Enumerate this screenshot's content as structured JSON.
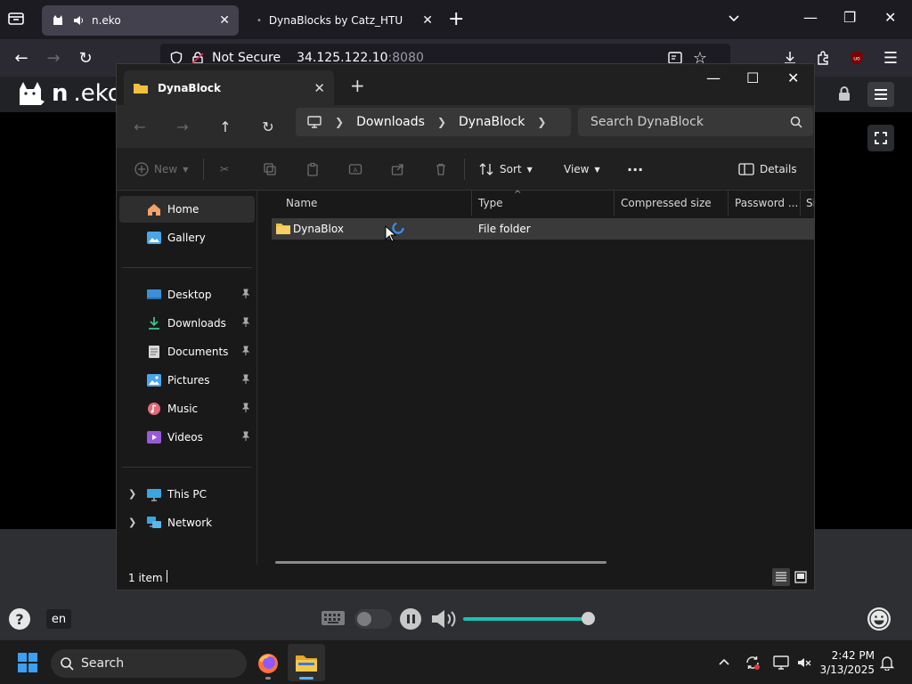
{
  "browser": {
    "tabs": [
      {
        "title": "n.eko",
        "active": true
      },
      {
        "title": "DynaBlocks by Catz_HTU",
        "active": false
      }
    ],
    "security_label": "Not Secure",
    "url_host": "34.125.122.10",
    "url_port": ":8080"
  },
  "neko": {
    "logo_bold": "n",
    "logo_rest": ".eko",
    "language": "en",
    "help": "?",
    "volume_fraction": 0.95
  },
  "explorer": {
    "tab_title": "DynaBlock",
    "breadcrumb": [
      "Downloads",
      "DynaBlock"
    ],
    "search_placeholder": "Search DynaBlock",
    "toolbar": {
      "new_label": "New",
      "sort_label": "Sort",
      "view_label": "View",
      "more_label": "···",
      "details_label": "Details"
    },
    "sidebar": {
      "home": "Home",
      "gallery": "Gallery",
      "quick": [
        "Desktop",
        "Downloads",
        "Documents",
        "Pictures",
        "Music",
        "Videos"
      ],
      "this_pc": "This PC",
      "network": "Network"
    },
    "columns": [
      "Name",
      "Type",
      "Compressed size",
      "Password ...",
      "Si"
    ],
    "files": [
      {
        "name": "DynaBlox",
        "type": "File folder"
      }
    ],
    "status_count": "1 item"
  },
  "taskbar": {
    "search_placeholder": "Search",
    "time": "2:42 PM",
    "date": "3/13/2025"
  },
  "colors": {
    "accent": "#3aa0f3",
    "folder": "#f0c040",
    "volume": "#19c3b3"
  }
}
